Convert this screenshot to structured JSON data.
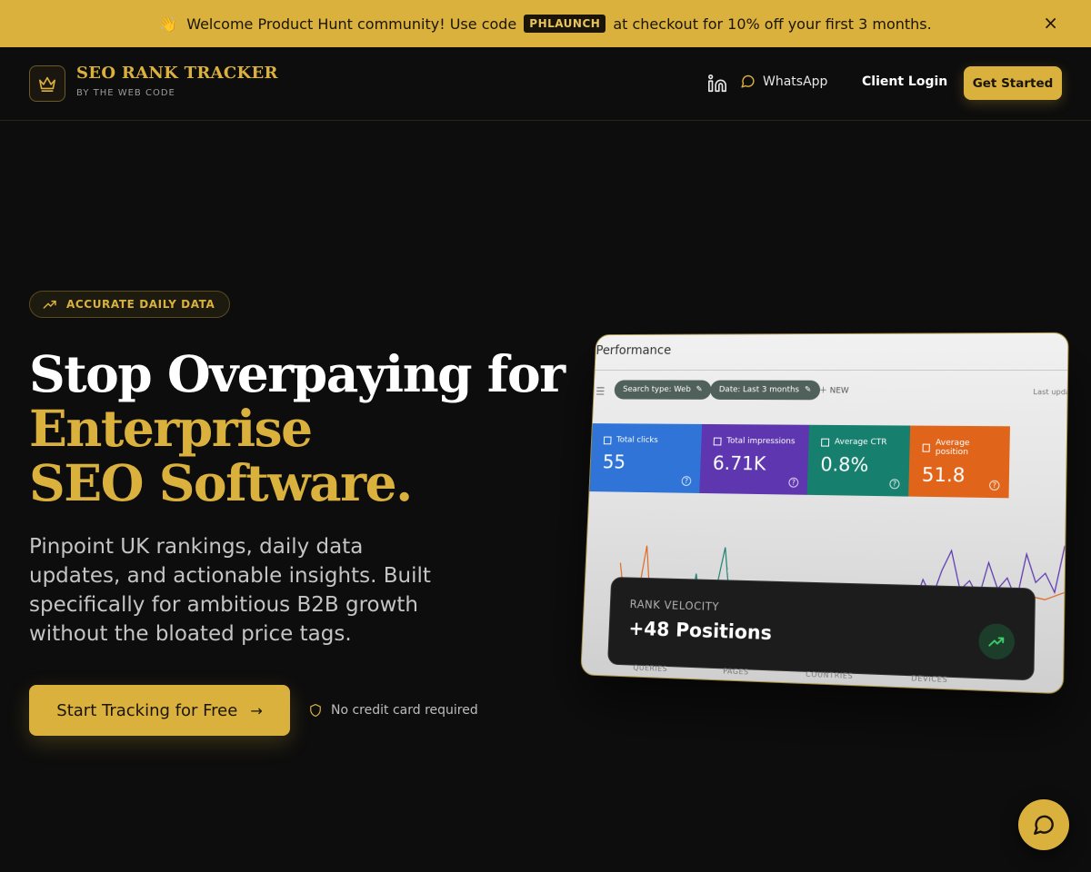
{
  "banner": {
    "emoji": "👋",
    "text_before": "Welcome Product Hunt community! Use code",
    "code": "PHLAUNCH",
    "text_after": "at checkout for 10% off your first 3 months.",
    "close_icon": "×"
  },
  "header": {
    "logo_icon": "crown-icon",
    "brand_name": "SEO RANK TRACKER",
    "brand_sub": "BY THE WEB CODE",
    "nav": {
      "linkedin_icon": "linkedin-icon",
      "whatsapp_label": "WhatsApp",
      "client_login": "Client Login",
      "get_started": "Get Started"
    }
  },
  "hero": {
    "badge": "ACCURATE DAILY DATA",
    "headline_line1": "Stop Overpaying for",
    "headline_line2": "Enterprise",
    "headline_line3": "SEO Software.",
    "description": "Pinpoint UK rankings, daily data updates, and actionable insights. Built specifically for ambitious B2B growth without the bloated price tags.",
    "cta_label": "Start Tracking for Free",
    "cta_arrow": "→",
    "no_card": "No credit card required"
  },
  "preview": {
    "title": "Performance",
    "chip_search": "Search type: Web",
    "chip_date": "Date: Last 3 months",
    "new_label": "NEW",
    "last_updated": "Last update",
    "metrics": [
      {
        "label": "Total clicks",
        "value": "55"
      },
      {
        "label": "Total impressions",
        "value": "6.71K"
      },
      {
        "label": "Average CTR",
        "value": "0.8%"
      },
      {
        "label": "Average position",
        "value": "51.8"
      }
    ],
    "tabs": [
      "QUERIES",
      "PAGES",
      "COUNTRIES",
      "DEVICES"
    ],
    "rank_velocity": {
      "label": "RANK VELOCITY",
      "value": "+48 Positions"
    }
  },
  "colors": {
    "accent": "#dbb13d",
    "background": "#0d0d0d",
    "clicks": "#2f74d6",
    "impressions": "#5e36b0",
    "ctr": "#167f6e",
    "position": "#e0651b"
  },
  "chat_icon": "chat-bubble-icon"
}
